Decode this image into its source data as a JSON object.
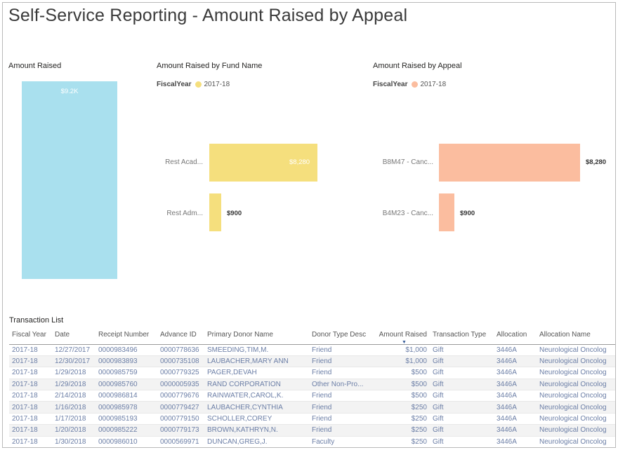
{
  "page": {
    "title": "Self-Service Reporting - Amount Raised by Appeal"
  },
  "amount_raised": {
    "title": "Amount Raised",
    "value_label": "$9.2K",
    "color": "#a9e0ee"
  },
  "fund_chart": {
    "title": "Amount Raised by Fund Name",
    "legend_title": "FiscalYear",
    "legend_item": "2017-18",
    "color": "#f5df7d"
  },
  "appeal_chart": {
    "title": "Amount Raised by Appeal",
    "legend_title": "FiscalYear",
    "legend_item": "2017-18",
    "color": "#fbbd9f"
  },
  "chart_data": [
    {
      "type": "bar",
      "title": "Amount Raised",
      "categories": [
        ""
      ],
      "values": [
        9180
      ],
      "value_labels": [
        "$9.2K"
      ]
    },
    {
      "type": "bar",
      "orientation": "horizontal",
      "title": "Amount Raised by Fund Name",
      "legend": [
        "2017-18"
      ],
      "categories": [
        "Rest Acad...",
        "Rest Adm..."
      ],
      "values": [
        8280,
        900
      ],
      "value_labels": [
        "$8,280",
        "$900"
      ]
    },
    {
      "type": "bar",
      "orientation": "horizontal",
      "title": "Amount Raised by Appeal",
      "legend": [
        "2017-18"
      ],
      "categories": [
        "B8M47 - Canc...",
        "B4M23 - Canc..."
      ],
      "values": [
        8280,
        900
      ],
      "value_labels": [
        "$8,280",
        "$900"
      ]
    }
  ],
  "transactions": {
    "title": "Transaction List",
    "columns": [
      "Fiscal Year",
      "Date",
      "Receipt Number",
      "Advance ID",
      "Primary Donor Name",
      "Donor Type Desc",
      "Amount Raised",
      "Transaction Type",
      "Allocation",
      "Allocation Name"
    ],
    "rows": [
      [
        "2017-18",
        "12/27/2017",
        "0000983496",
        "0000778636",
        "SMEEDING,TIM,M.",
        "Friend",
        "$1,000",
        "Gift",
        "3446A",
        "Neurological Oncolog"
      ],
      [
        "2017-18",
        "12/30/2017",
        "0000983893",
        "0000735108",
        "LAUBACHER,MARY ANN",
        "Friend",
        "$1,000",
        "Gift",
        "3446A",
        "Neurological Oncolog"
      ],
      [
        "2017-18",
        "1/29/2018",
        "0000985759",
        "0000779325",
        "PAGER,DEVAH",
        "Friend",
        "$500",
        "Gift",
        "3446A",
        "Neurological Oncolog"
      ],
      [
        "2017-18",
        "1/29/2018",
        "0000985760",
        "0000005935",
        "RAND CORPORATION",
        "Other Non-Pro...",
        "$500",
        "Gift",
        "3446A",
        "Neurological Oncolog"
      ],
      [
        "2017-18",
        "2/14/2018",
        "0000986814",
        "0000779676",
        "RAINWATER,CAROL,K.",
        "Friend",
        "$500",
        "Gift",
        "3446A",
        "Neurological Oncolog"
      ],
      [
        "2017-18",
        "1/16/2018",
        "0000985978",
        "0000779427",
        "LAUBACHER,CYNTHIA",
        "Friend",
        "$250",
        "Gift",
        "3446A",
        "Neurological Oncolog"
      ],
      [
        "2017-18",
        "1/17/2018",
        "0000985193",
        "0000779150",
        "SCHOLLER,COREY",
        "Friend",
        "$250",
        "Gift",
        "3446A",
        "Neurological Oncolog"
      ],
      [
        "2017-18",
        "1/20/2018",
        "0000985222",
        "0000779173",
        "BROWN,KATHRYN,N.",
        "Friend",
        "$250",
        "Gift",
        "3446A",
        "Neurological Oncolog"
      ],
      [
        "2017-18",
        "1/30/2018",
        "0000986010",
        "0000569971",
        "DUNCAN,GREG,J.",
        "Faculty",
        "$250",
        "Gift",
        "3446A",
        "Neurological Oncolog"
      ]
    ]
  }
}
